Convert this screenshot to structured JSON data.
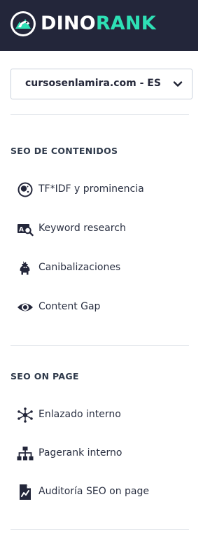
{
  "brand": {
    "part1": "DINO",
    "part2": "RANK"
  },
  "project_select": {
    "value": "cursosenlamira.com - ES"
  },
  "sections": [
    {
      "title": "SEO DE CONTENIDOS",
      "items": [
        {
          "label": "TF*IDF y prominencia",
          "icon": "tfidf-icon"
        },
        {
          "label": "Keyword research",
          "icon": "keyword-search-icon"
        },
        {
          "label": "Canibalizaciones",
          "icon": "dinosaur-icon"
        },
        {
          "label": "Content Gap",
          "icon": "eye-icon"
        }
      ]
    },
    {
      "title": "SEO ON PAGE",
      "items": [
        {
          "label": "Enlazado interno",
          "icon": "network-icon"
        },
        {
          "label": "Pagerank interno",
          "icon": "sitemap-icon"
        },
        {
          "label": "Auditoría SEO on page",
          "icon": "audit-document-icon"
        }
      ]
    }
  ],
  "colors": {
    "topbar": "#23263a",
    "accent": "#2ee0b5",
    "text": "#2a3042"
  }
}
